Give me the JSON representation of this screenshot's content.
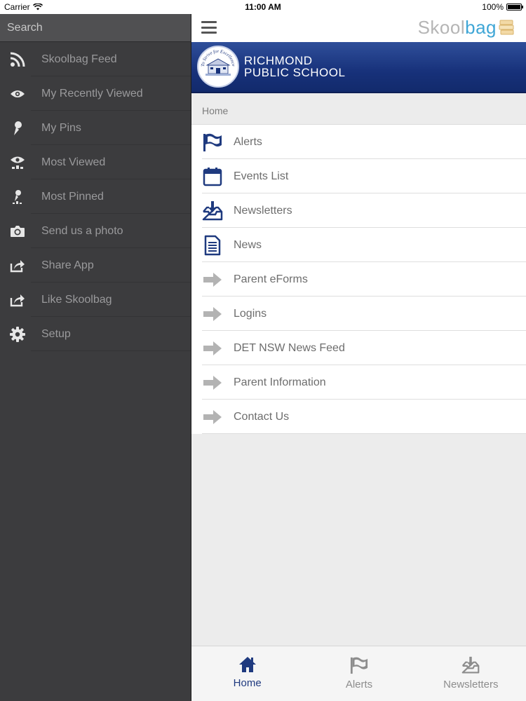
{
  "status_bar": {
    "carrier": "Carrier",
    "time": "11:00 AM",
    "battery": "100%",
    "battery_level": 1.0
  },
  "sidebar": {
    "search_placeholder": "Search",
    "items": [
      {
        "label": "Skoolbag Feed",
        "icon": "rss-icon"
      },
      {
        "label": "My Recently Viewed",
        "icon": "eye-icon"
      },
      {
        "label": "My Pins",
        "icon": "pin-icon"
      },
      {
        "label": "Most Viewed",
        "icon": "eye-stats-icon"
      },
      {
        "label": "Most Pinned",
        "icon": "pin-stats-icon"
      },
      {
        "label": "Send us a photo",
        "icon": "camera-icon"
      },
      {
        "label": "Share App",
        "icon": "share-icon"
      },
      {
        "label": "Like Skoolbag",
        "icon": "share-icon"
      },
      {
        "label": "Setup",
        "icon": "gear-icon"
      }
    ]
  },
  "header": {
    "brand_part1": "Skool",
    "brand_part2": "bag",
    "brand_color": "#3fa6d6"
  },
  "banner": {
    "school_line1": "RICHMOND",
    "school_line2": "PUBLIC SCHOOL",
    "logo_motto": "To Strive for Excellence",
    "banner_color": "#17317a"
  },
  "breadcrumb": "Home",
  "menu": [
    {
      "label": "Alerts",
      "icon": "flag-icon"
    },
    {
      "label": "Events List",
      "icon": "calendar-icon"
    },
    {
      "label": "Newsletters",
      "icon": "inbox-download-icon"
    },
    {
      "label": "News",
      "icon": "document-icon"
    },
    {
      "label": "Parent eForms",
      "icon": "arrow-right-icon"
    },
    {
      "label": "Logins",
      "icon": "arrow-right-icon"
    },
    {
      "label": "DET NSW News Feed",
      "icon": "arrow-right-icon"
    },
    {
      "label": "Parent Information",
      "icon": "arrow-right-icon"
    },
    {
      "label": "Contact Us",
      "icon": "arrow-right-icon"
    }
  ],
  "tabs": [
    {
      "label": "Home",
      "icon": "home-icon",
      "active": true
    },
    {
      "label": "Alerts",
      "icon": "flag-icon",
      "active": false
    },
    {
      "label": "Newsletters",
      "icon": "inbox-download-icon",
      "active": false
    }
  ]
}
